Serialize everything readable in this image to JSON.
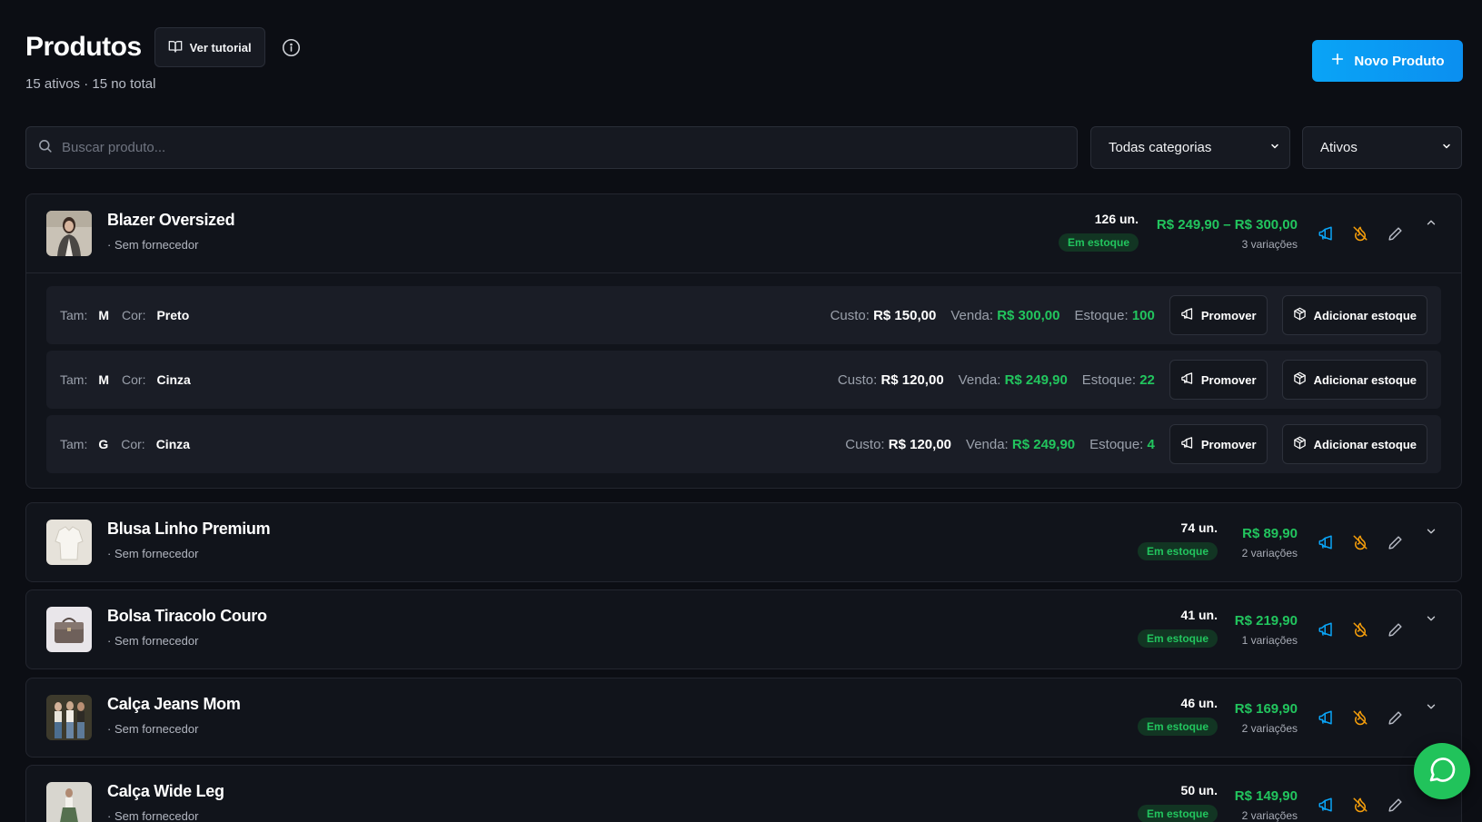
{
  "header": {
    "title": "Produtos",
    "tutorial_label": "Ver tutorial",
    "subtitle": "15 ativos · 15 no total",
    "new_product_label": "Novo Produto"
  },
  "filters": {
    "search_placeholder": "Buscar produto...",
    "category_selected": "Todas categorias",
    "status_selected": "Ativos"
  },
  "colors": {
    "accent": "#0aa4f6",
    "success": "#22c55e",
    "warning": "#f59e0b"
  },
  "products": [
    {
      "name": "Blazer Oversized",
      "supplier": "· Sem fornecedor",
      "stock_qty": "126 un.",
      "stock_status": "Em estoque",
      "price": "R$ 249,90 – R$ 300,00",
      "variations": "3 variações",
      "variants": [
        {
          "size_label": "Tam:",
          "size": "M",
          "color_label": "Cor:",
          "color": "Preto",
          "cost_label": "Custo:",
          "cost": "R$ 150,00",
          "sale_label": "Venda:",
          "sale": "R$ 300,00",
          "stock_label": "Estoque:",
          "stock": "100",
          "promote_label": "Promover",
          "add_stock_label": "Adicionar estoque"
        },
        {
          "size_label": "Tam:",
          "size": "M",
          "color_label": "Cor:",
          "color": "Cinza",
          "cost_label": "Custo:",
          "cost": "R$ 120,00",
          "sale_label": "Venda:",
          "sale": "R$ 249,90",
          "stock_label": "Estoque:",
          "stock": "22",
          "promote_label": "Promover",
          "add_stock_label": "Adicionar estoque"
        },
        {
          "size_label": "Tam:",
          "size": "G",
          "color_label": "Cor:",
          "color": "Cinza",
          "cost_label": "Custo:",
          "cost": "R$ 120,00",
          "sale_label": "Venda:",
          "sale": "R$ 249,90",
          "stock_label": "Estoque:",
          "stock": "4",
          "promote_label": "Promover",
          "add_stock_label": "Adicionar estoque"
        }
      ]
    },
    {
      "name": "Blusa Linho Premium",
      "supplier": "· Sem fornecedor",
      "stock_qty": "74 un.",
      "stock_status": "Em estoque",
      "price": "R$ 89,90",
      "variations": "2 variações"
    },
    {
      "name": "Bolsa Tiracolo Couro",
      "supplier": "· Sem fornecedor",
      "stock_qty": "41 un.",
      "stock_status": "Em estoque",
      "price": "R$ 219,90",
      "variations": "1 variações"
    },
    {
      "name": "Calça Jeans Mom",
      "supplier": "· Sem fornecedor",
      "stock_qty": "46 un.",
      "stock_status": "Em estoque",
      "price": "R$ 169,90",
      "variations": "2 variações"
    },
    {
      "name": "Calça Wide Leg",
      "supplier": "· Sem fornecedor",
      "stock_qty": "50 un.",
      "stock_status": "Em estoque",
      "price": "R$ 149,90",
      "variations": "2 variações"
    }
  ]
}
